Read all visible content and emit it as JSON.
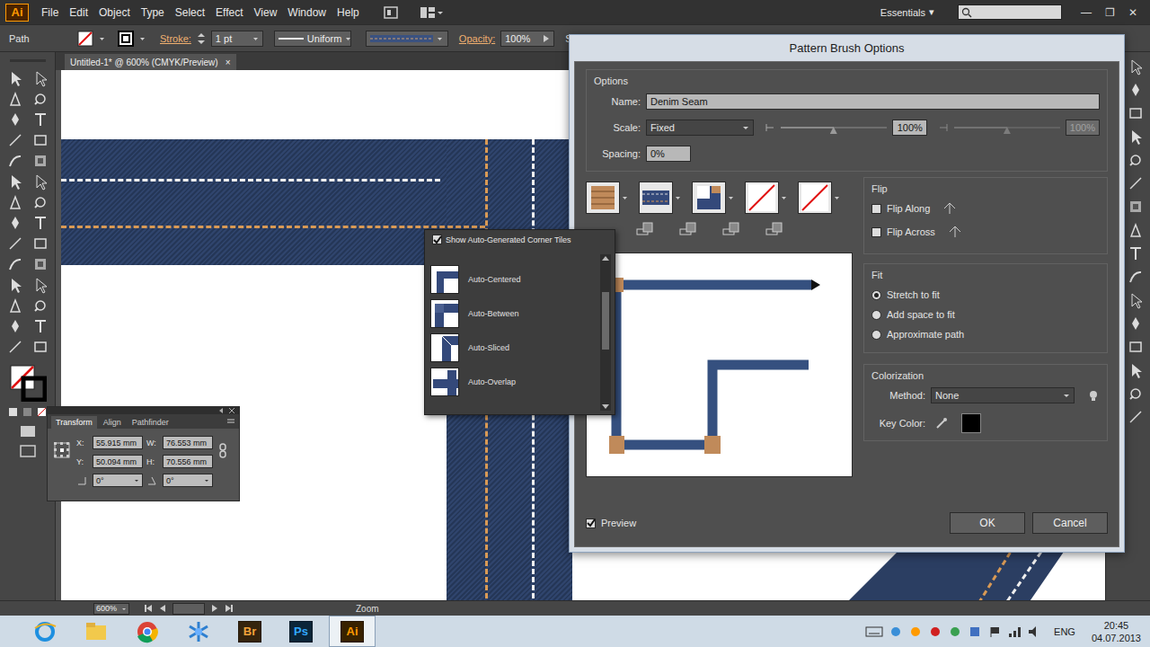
{
  "app": {
    "logo": "Ai"
  },
  "menu": [
    "File",
    "Edit",
    "Object",
    "Type",
    "Select",
    "Effect",
    "View",
    "Window",
    "Help"
  ],
  "workspace": {
    "label": "Essentials",
    "arrow": "▾"
  },
  "window_controls": [
    "—",
    "❐",
    "✕"
  ],
  "control_bar": {
    "selection": "Path",
    "stroke_label": "Stroke:",
    "stroke_weight": "1 pt",
    "profile": "Uniform",
    "opacity_label": "Opacity:",
    "opacity": "100%",
    "style_label": "Styl"
  },
  "document_tab": {
    "title": "Untitled-1* @ 600% (CMYK/Preview)",
    "close": "×"
  },
  "corner_menu": {
    "show_auto": {
      "label": "Show Auto-Generated Corner Tiles",
      "checked": true
    },
    "items": [
      {
        "label": "Auto-Centered",
        "selected": false
      },
      {
        "label": "Auto-Between",
        "selected": false
      },
      {
        "label": "Auto-Sliced",
        "selected": false
      },
      {
        "label": "Auto-Overlap",
        "selected": false
      }
    ]
  },
  "transform_panel": {
    "tabs": [
      {
        "label": "Transform",
        "selected": true
      },
      {
        "label": "Align",
        "selected": false
      },
      {
        "label": "Pathfinder",
        "selected": false
      }
    ],
    "fields": [
      {
        "label": "X:",
        "value": "55.915 mm"
      },
      {
        "label": "W:",
        "value": "76.553 mm"
      },
      {
        "label": "Y:",
        "value": "50.094 mm"
      },
      {
        "label": "H:",
        "value": "70.556 mm"
      }
    ],
    "rotate": "0°",
    "shear": "0°"
  },
  "dialog": {
    "title": "Pattern Brush Options",
    "options_label": "Options",
    "name_label": "Name:",
    "name": "Denim Seam",
    "scale_label": "Scale:",
    "scale_mode": "Fixed",
    "scale_min": {
      "value": "100%",
      "level": 0.5,
      "disabled": false
    },
    "scale_max": {
      "value": "100%",
      "level": 0.5,
      "disabled": true
    },
    "spacing_label": "Spacing:",
    "spacing": "0%",
    "tiles": [
      {
        "kind": "corner"
      },
      {
        "kind": "side"
      },
      {
        "kind": "inner"
      },
      {
        "kind": "none"
      },
      {
        "kind": "none"
      }
    ],
    "flip_label": "Flip",
    "flip": [
      {
        "label": "Flip Along",
        "checked": false
      },
      {
        "label": "Flip Across",
        "checked": false
      }
    ],
    "fit_label": "Fit",
    "fit": [
      {
        "label": "Stretch to fit",
        "selected": true
      },
      {
        "label": "Add space to fit",
        "selected": false
      },
      {
        "label": "Approximate path",
        "selected": false
      }
    ],
    "colorization_label": "Colorization",
    "method_label": "Method:",
    "method": "None",
    "key_color_label": "Key Color:",
    "key_color": "#000000",
    "preview": {
      "label": "Preview",
      "checked": true
    },
    "buttons": [
      "OK",
      "Cancel"
    ]
  },
  "status_bar": {
    "zoom": "600%",
    "tool": "Zoom"
  },
  "taskbar": {
    "apps": [
      {
        "label": "Br",
        "color": "#f2a33a",
        "active": false
      },
      {
        "label": "Ps",
        "color": "#31a8ff",
        "active": false
      },
      {
        "label": "Ai",
        "color": "#ff9a00",
        "active": true
      }
    ],
    "language": "ENG",
    "time": "20:45",
    "date": "04.07.2013"
  }
}
